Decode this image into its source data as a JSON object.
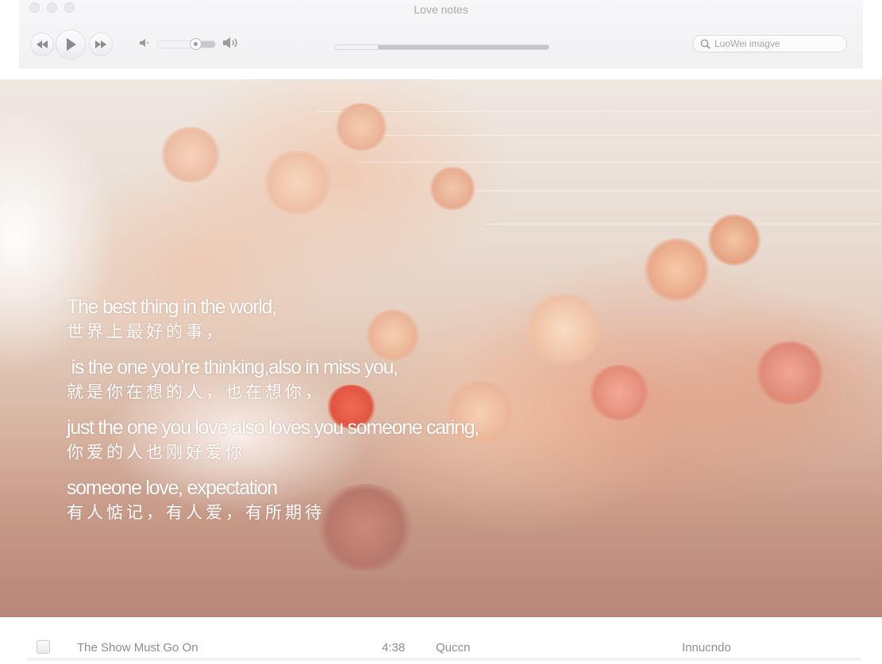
{
  "window": {
    "title": "Love notes"
  },
  "player": {
    "controls": {
      "previous": "rewind-icon",
      "play": "play-icon",
      "next": "fast-forward-icon"
    },
    "volume": {
      "level": 0.35,
      "min_icon": "speaker-low-icon",
      "max_icon": "speaker-high-icon"
    },
    "progress": {
      "fraction": 0.2
    },
    "search": {
      "placeholder": "LuoWei imagve",
      "icon": "search-icon"
    }
  },
  "lyrics": [
    {
      "en": "The best thing in the world,",
      "zh": "世界上最好的事，"
    },
    {
      "en": " is the one you’re thinking,also in miss you,",
      "zh": "就是你在想的人，也在想你，"
    },
    {
      "en": "just the one you love also loves you someone caring,",
      "zh": "你爱的人也刚好爱你"
    },
    {
      "en": "someone love, expectation",
      "zh": "有人惦记，有人爱，有所期待"
    }
  ],
  "tracks": [
    {
      "title": "The Show Must Go On",
      "duration": "4:38",
      "artist": "Quccn",
      "album": "Innucndo",
      "checked": false
    }
  ],
  "colors": {
    "lyric_text": "#ffffff",
    "chrome_bg": "#f4f4f6",
    "track_text": "#8c8c91"
  }
}
